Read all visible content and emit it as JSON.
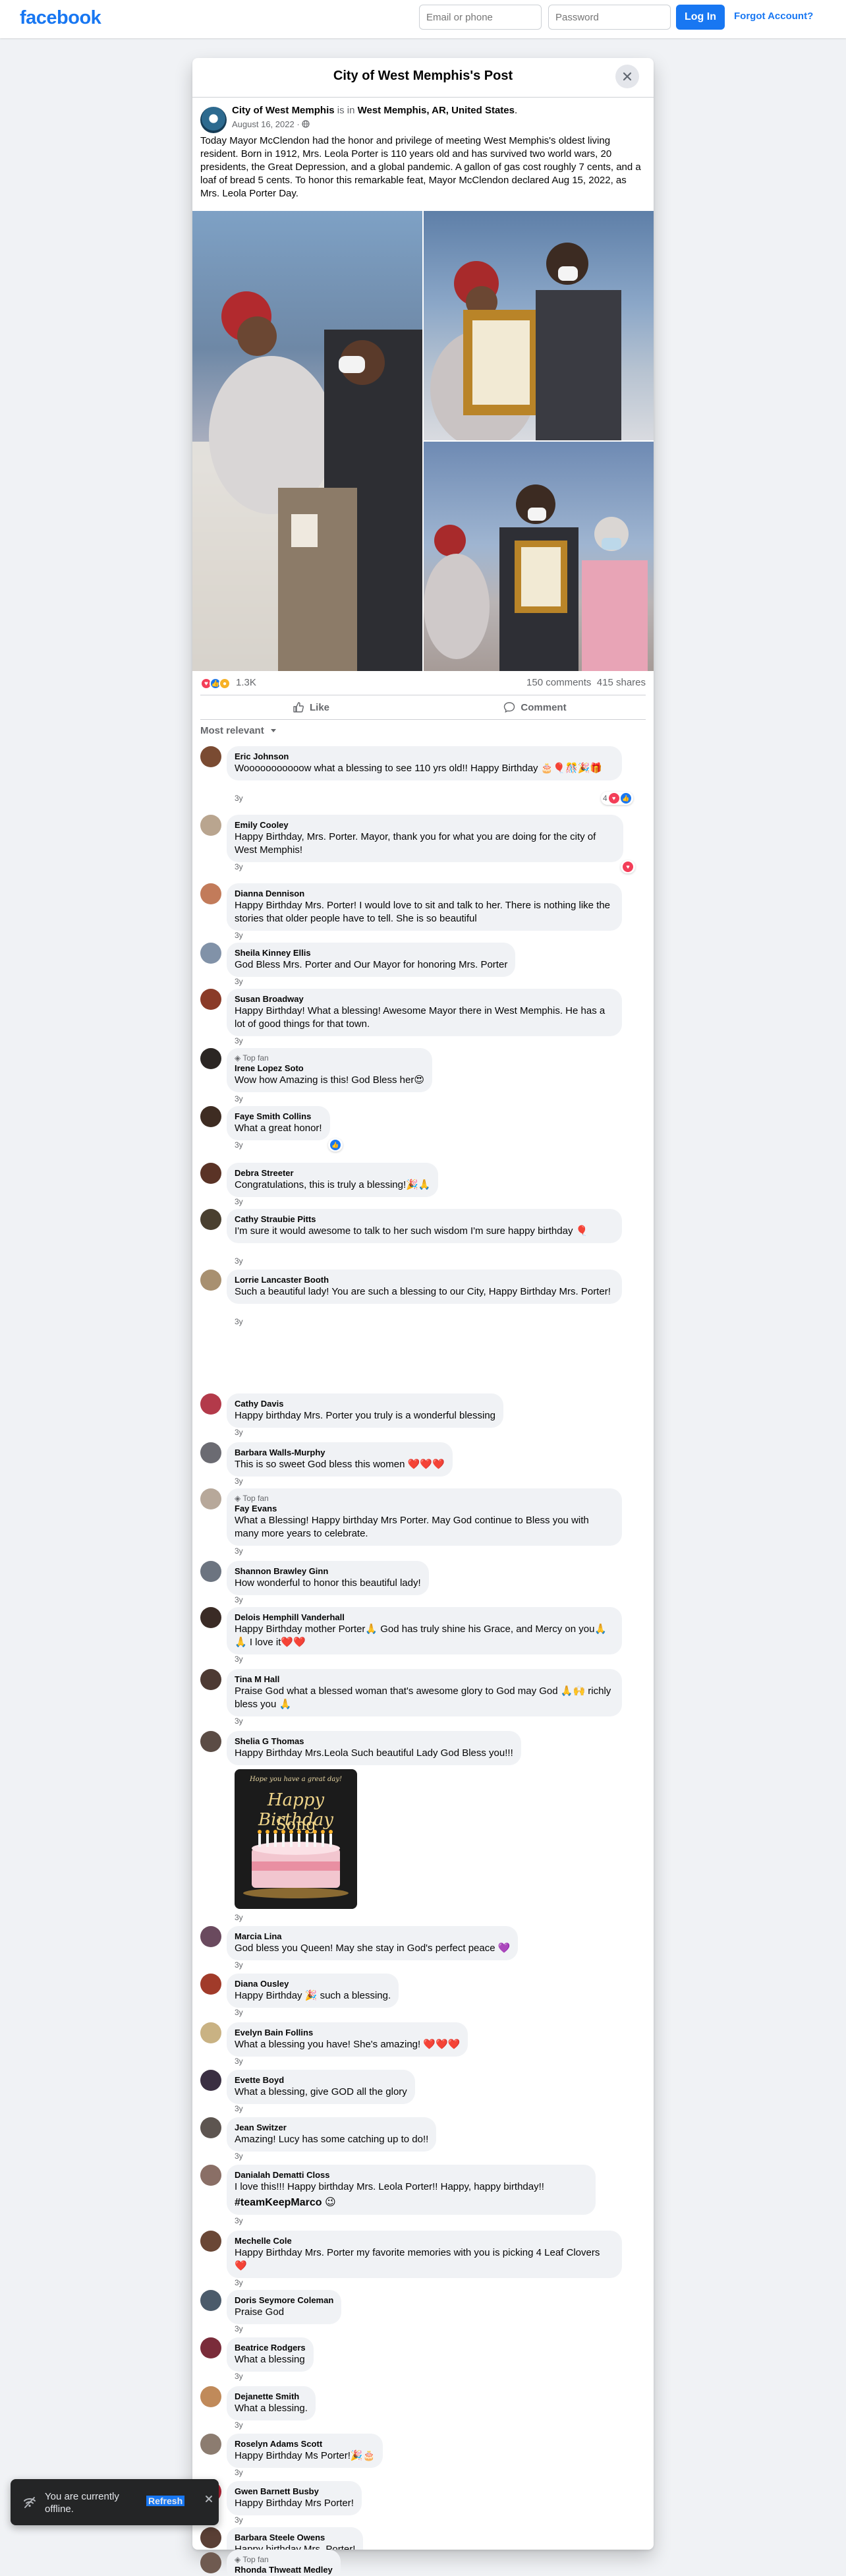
{
  "header": {
    "logo": "facebook",
    "email_placeholder": "Email or phone",
    "password_placeholder": "Password",
    "login_label": "Log In",
    "forgot_label": "Forgot Account?"
  },
  "dialog": {
    "title": "City of West Memphis's Post",
    "close_icon": "close-icon"
  },
  "post": {
    "author": "City of West Memphis",
    "is_in": " is in ",
    "location": "West Memphis, AR, United States",
    "location_suffix": ".",
    "date": "August 16, 2022",
    "privacy_icon": "globe-icon",
    "text": "Today Mayor McClendon had the honor and privilege of meeting West Memphis's oldest living resident. Born in 1912, Mrs. Leola Porter is 110 years old and has survived two world wars, 20 presidents, the Great Depression, and a global pandemic. A gallon of gas cost roughly 7 cents, and a loaf of bread 5 cents. To honor this remarkable feat, Mayor McClendon declared Aug 15, 2022, as Mrs. Leola Porter Day.",
    "reaction_count": "1.3K",
    "comments_count": "150 comments",
    "shares_count": "415 shares",
    "like_label": "Like",
    "comment_label": "Comment",
    "sort_label": "Most relevant"
  },
  "comments": [
    {
      "name": "Eric Johnson",
      "text": "Wooooooooooow what a blessing to see 110 yrs old!! Happy Birthday 🎂🎈🎊🎉🎁",
      "time": "3y",
      "reactions": "4"
    },
    {
      "name": "Emily Cooley",
      "text": "Happy Birthday, Mrs. Porter. Mayor, thank you for what you are doing for the city of West Memphis!",
      "time": "3y"
    },
    {
      "name": "Dianna Dennison",
      "text": "Happy Birthday Mrs. Porter! I would love to sit and talk to her. There is nothing like the stories that older people have to tell. She is so beautiful",
      "time": "3y"
    },
    {
      "name": "Sheila Kinney Ellis",
      "text": "God Bless Mrs. Porter and Our Mayor for honoring Mrs. Porter",
      "time": "3y"
    },
    {
      "name": "Susan Broadway",
      "text": "Happy Birthday! What a blessing! Awesome Mayor there in West Memphis. He has a lot of good things for that town.",
      "time": "3y"
    },
    {
      "badge": "Top fan",
      "name": "Irene Lopez Soto",
      "text": "Wow how Amazing is this! God Bless her😍",
      "time": "3y"
    },
    {
      "name": "Faye Smith Collins",
      "text": "What a great honor!",
      "time": "3y"
    },
    {
      "name": "Debra Streeter",
      "text": "Congratulations, this is truly a blessing!🎉🙏",
      "time": "3y"
    },
    {
      "name": "Cathy Straubie Pitts",
      "text": "I'm sure it would awesome to talk to her such wisdom I'm sure happy birthday 🎈",
      "time": "3y"
    },
    {
      "name": "Lorrie Lancaster Booth",
      "text": "Such a beautiful lady! You are such a blessing to our City, Happy Birthday Mrs. Porter!",
      "time": "3y"
    },
    {
      "name": "Cathy Davis",
      "text": "Happy birthday Mrs. Porter you truly is a wonderful blessing",
      "time": "3y"
    },
    {
      "name": "Barbara Walls-Murphy",
      "text": "This is so sweet God bless this women ❤️❤️❤️",
      "time": "3y"
    },
    {
      "badge": "Top fan",
      "name": "Fay Evans",
      "text": "What a Blessing! Happy birthday Mrs Porter. May God continue to Bless you with many more years to celebrate.",
      "time": "3y"
    },
    {
      "name": "Shannon Brawley Ginn",
      "text": "How wonderful to honor this beautiful lady!",
      "time": "3y"
    },
    {
      "name": "Delois Hemphill Vanderhall",
      "text": "Happy Birthday mother Porter🙏 God has truly shine his Grace, and Mercy on you🙏🙏 I love it❤️❤️",
      "time": "3y"
    },
    {
      "name": "Tina M Hall",
      "text": "Praise God what a blessed woman that's awesome glory to God may God 🙏🙌 richly bless you 🙏",
      "time": "3y"
    },
    {
      "name": "Shelia G Thomas",
      "text": "Happy Birthday Mrs.Leola Such beautiful Lady God Bless you!!!",
      "time": "3y",
      "gif_top": "Hope you have a great day!",
      "gif_title": "Happy Birthday",
      "gif_sub": "Song"
    },
    {
      "name": "Marcia Lina",
      "text": "God bless you Queen! May she stay in God's perfect peace 💜",
      "time": "3y"
    },
    {
      "name": "Diana Ousley",
      "text": "Happy Birthday 🎉 such a blessing.",
      "time": "3y"
    },
    {
      "name": "Evelyn Bain Follins",
      "text": "What a blessing you have! She's amazing! ❤️❤️❤️",
      "time": "3y"
    },
    {
      "name": "Evette Boyd",
      "text": "What a blessing, give GOD all the glory",
      "time": "3y"
    },
    {
      "name": "Jean Switzer",
      "text": "Amazing! Lucy has some catching up to do!!",
      "time": "3y"
    },
    {
      "name": "Danialah Dematti Closs",
      "text": "I love this!!! Happy birthday Mrs. Leola Porter!! Happy, happy birthday!!",
      "text2": "#teamKeepMarco 😉",
      "time": "3y"
    },
    {
      "name": "Mechelle Cole",
      "text": "Happy Birthday Mrs. Porter my favorite memories with you is picking 4 Leaf Clovers ❤️",
      "time": "3y"
    },
    {
      "name": "Doris Seymore Coleman",
      "text": "Praise God",
      "time": "3y"
    },
    {
      "name": "Beatrice Rodgers",
      "text": "What a blessing",
      "time": "3y"
    },
    {
      "name": "Dejanette Smith",
      "text": "What a blessing.",
      "time": "3y"
    },
    {
      "name": "Roselyn Adams Scott",
      "text": "Happy Birthday Ms Porter!🎉🎂",
      "time": "3y"
    },
    {
      "name": "Gwen Barnett Busby",
      "text": "Happy Birthday Mrs Porter!",
      "time": "3y"
    },
    {
      "name": "Barbara Steele Owens",
      "text": "Happy birthday Mrs. Porter!",
      "time": "3y"
    },
    {
      "badge": "Top fan",
      "name": "Rhonda Thweatt Medley"
    }
  ],
  "toast": {
    "text": "You are currently offline.",
    "refresh_label": "Refresh",
    "icon": "wifi-off-icon"
  },
  "colors": {
    "brand": "#1877f2",
    "like": "#1877f2",
    "love": "#f33e58",
    "care": "#f7b125"
  }
}
